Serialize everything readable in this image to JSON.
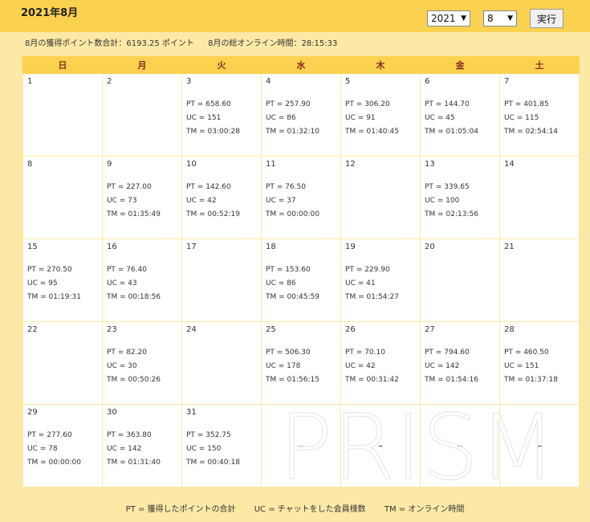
{
  "header": {
    "title": "2021年8月",
    "year": "2021",
    "month": "8",
    "run_label": "実行"
  },
  "summary": {
    "points": "8月の獲得ポイント数合計：6193.25 ポイント",
    "online": "8月の総オンライン時間：28:15:33"
  },
  "weekdays": [
    "日",
    "月",
    "火",
    "水",
    "木",
    "金",
    "土"
  ],
  "weeks": [
    [
      {
        "day": "1"
      },
      {
        "day": "2"
      },
      {
        "day": "3",
        "pt": "PT = 658.60",
        "uc": "UC = 151",
        "tm": "TM = 03:00:28"
      },
      {
        "day": "4",
        "pt": "PT = 257.90",
        "uc": "UC = 86",
        "tm": "TM = 01:32:10"
      },
      {
        "day": "5",
        "pt": "PT = 306.20",
        "uc": "UC = 91",
        "tm": "TM = 01:40:45"
      },
      {
        "day": "6",
        "pt": "PT = 144.70",
        "uc": "UC = 45",
        "tm": "TM = 01:05:04"
      },
      {
        "day": "7",
        "pt": "PT = 401.85",
        "uc": "UC = 115",
        "tm": "TM = 02:54:14"
      }
    ],
    [
      {
        "day": "8"
      },
      {
        "day": "9",
        "pt": "PT = 227.00",
        "uc": "UC = 73",
        "tm": "TM = 01:35:49"
      },
      {
        "day": "10",
        "pt": "PT = 142.60",
        "uc": "UC = 42",
        "tm": "TM = 00:52:19"
      },
      {
        "day": "11",
        "pt": "PT = 76.50",
        "uc": "UC = 37",
        "tm": "TM = 00:00:00"
      },
      {
        "day": "12"
      },
      {
        "day": "13",
        "pt": "PT = 339.65",
        "uc": "UC = 100",
        "tm": "TM = 02:13:56"
      },
      {
        "day": "14"
      }
    ],
    [
      {
        "day": "15",
        "pt": "PT = 270.50",
        "uc": "UC = 95",
        "tm": "TM = 01:19:31"
      },
      {
        "day": "16",
        "pt": "PT = 76.40",
        "uc": "UC = 43",
        "tm": "TM = 00:18:56"
      },
      {
        "day": "17"
      },
      {
        "day": "18",
        "pt": "PT = 153.60",
        "uc": "UC = 86",
        "tm": "TM = 00:45:59"
      },
      {
        "day": "19",
        "pt": "PT = 229.90",
        "uc": "UC = 41",
        "tm": "TM = 01:54:27"
      },
      {
        "day": "20"
      },
      {
        "day": "21"
      }
    ],
    [
      {
        "day": "22"
      },
      {
        "day": "23",
        "pt": "PT = 82.20",
        "uc": "UC = 30",
        "tm": "TM = 00:50:26"
      },
      {
        "day": "24"
      },
      {
        "day": "25",
        "pt": "PT = 506.30",
        "uc": "UC = 178",
        "tm": "TM = 01:56:15"
      },
      {
        "day": "26",
        "pt": "PT = 70.10",
        "uc": "UC = 42",
        "tm": "TM = 00:31:42"
      },
      {
        "day": "27",
        "pt": "PT = 794.60",
        "uc": "UC = 142",
        "tm": "TM = 01:54:16"
      },
      {
        "day": "28",
        "pt": "PT = 460.50",
        "uc": "UC = 151",
        "tm": "TM = 01:37:18"
      }
    ],
    [
      {
        "day": "29",
        "pt": "PT = 277.60",
        "uc": "UC = 78",
        "tm": "TM = 00:00:00"
      },
      {
        "day": "30",
        "pt": "PT = 363.80",
        "uc": "UC = 142",
        "tm": "TM = 01:31:40"
      },
      {
        "day": "31",
        "pt": "PT = 352.75",
        "uc": "UC = 150",
        "tm": "TM = 00:40:18"
      },
      {
        "dash": "–"
      },
      {
        "dash": "–"
      },
      {
        "dash": "–"
      },
      {
        "dash": "–"
      }
    ]
  ],
  "watermark": "PRISM",
  "legend": {
    "pt": "PT = 獲得したポイントの合計",
    "uc": "UC = チャットをした会員様数",
    "tm": "TM = オンライン時間"
  }
}
